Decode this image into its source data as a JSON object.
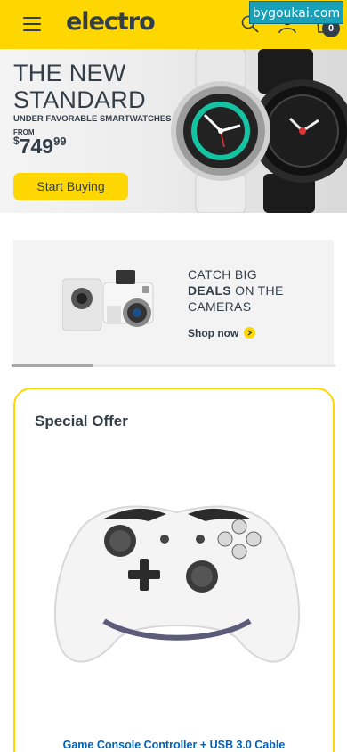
{
  "header": {
    "logo": "electro",
    "menu_icon": "hamburger-menu-icon",
    "search_icon": "search-icon",
    "account_icon": "user-icon",
    "cart_icon": "shopping-bag-icon",
    "cart_count": "0",
    "watermark": "bygoukai.com",
    "bg_color": "#fed700"
  },
  "hero": {
    "title": "THE NEW\nSTANDARD",
    "subtitle": "UNDER FAVORABLE SMARTWATCHES",
    "from_label": "FROM",
    "price_currency": "$",
    "price_int": "749",
    "price_dec": "99",
    "button_label": "Start Buying",
    "image": "smartwatches-image"
  },
  "promo": {
    "line1": "CATCH BIG",
    "line2_bold": "DEALS",
    "line2_rest": " ON THE",
    "line3": "CAMERAS",
    "link": "Shop now",
    "image": "camera-image",
    "carousel_progress": 0.25
  },
  "special_offer": {
    "title": "Special Offer",
    "product_name": "Game Console Controller + USB 3.0 Cable",
    "image": "game-controller-image",
    "border_color": "#fed700"
  }
}
